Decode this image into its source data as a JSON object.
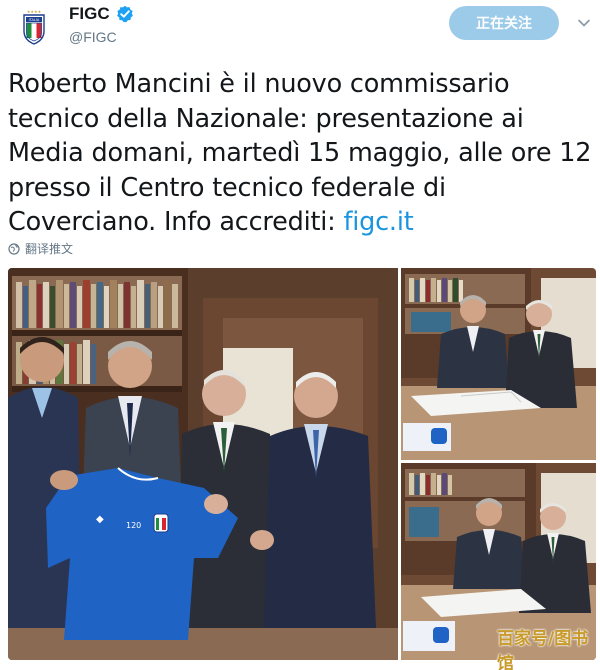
{
  "account": {
    "display_name": "FIGC",
    "handle": "@FIGC",
    "verified": true,
    "avatar_icon": "figc-crest-icon"
  },
  "actions": {
    "follow_label": "正在关注",
    "menu_icon": "chevron-down-icon"
  },
  "tweet": {
    "text": "Roberto Mancini è il nuovo commissario tecnico della Nazionale: presentazione ai Media domani, martedì 15 maggio, alle ore 12 presso il Centro tecnico federale di Coverciano.  Info accrediti: ",
    "link_text": "figc.it",
    "translate_label": "翻译推文",
    "translate_icon": "globe-icon"
  },
  "media": {
    "photo_count": 3
  },
  "watermark": "百家号/图书馆",
  "colors": {
    "link": "#1b95e0",
    "follow_button": "#9ccbea",
    "secondary_text": "#657786"
  }
}
